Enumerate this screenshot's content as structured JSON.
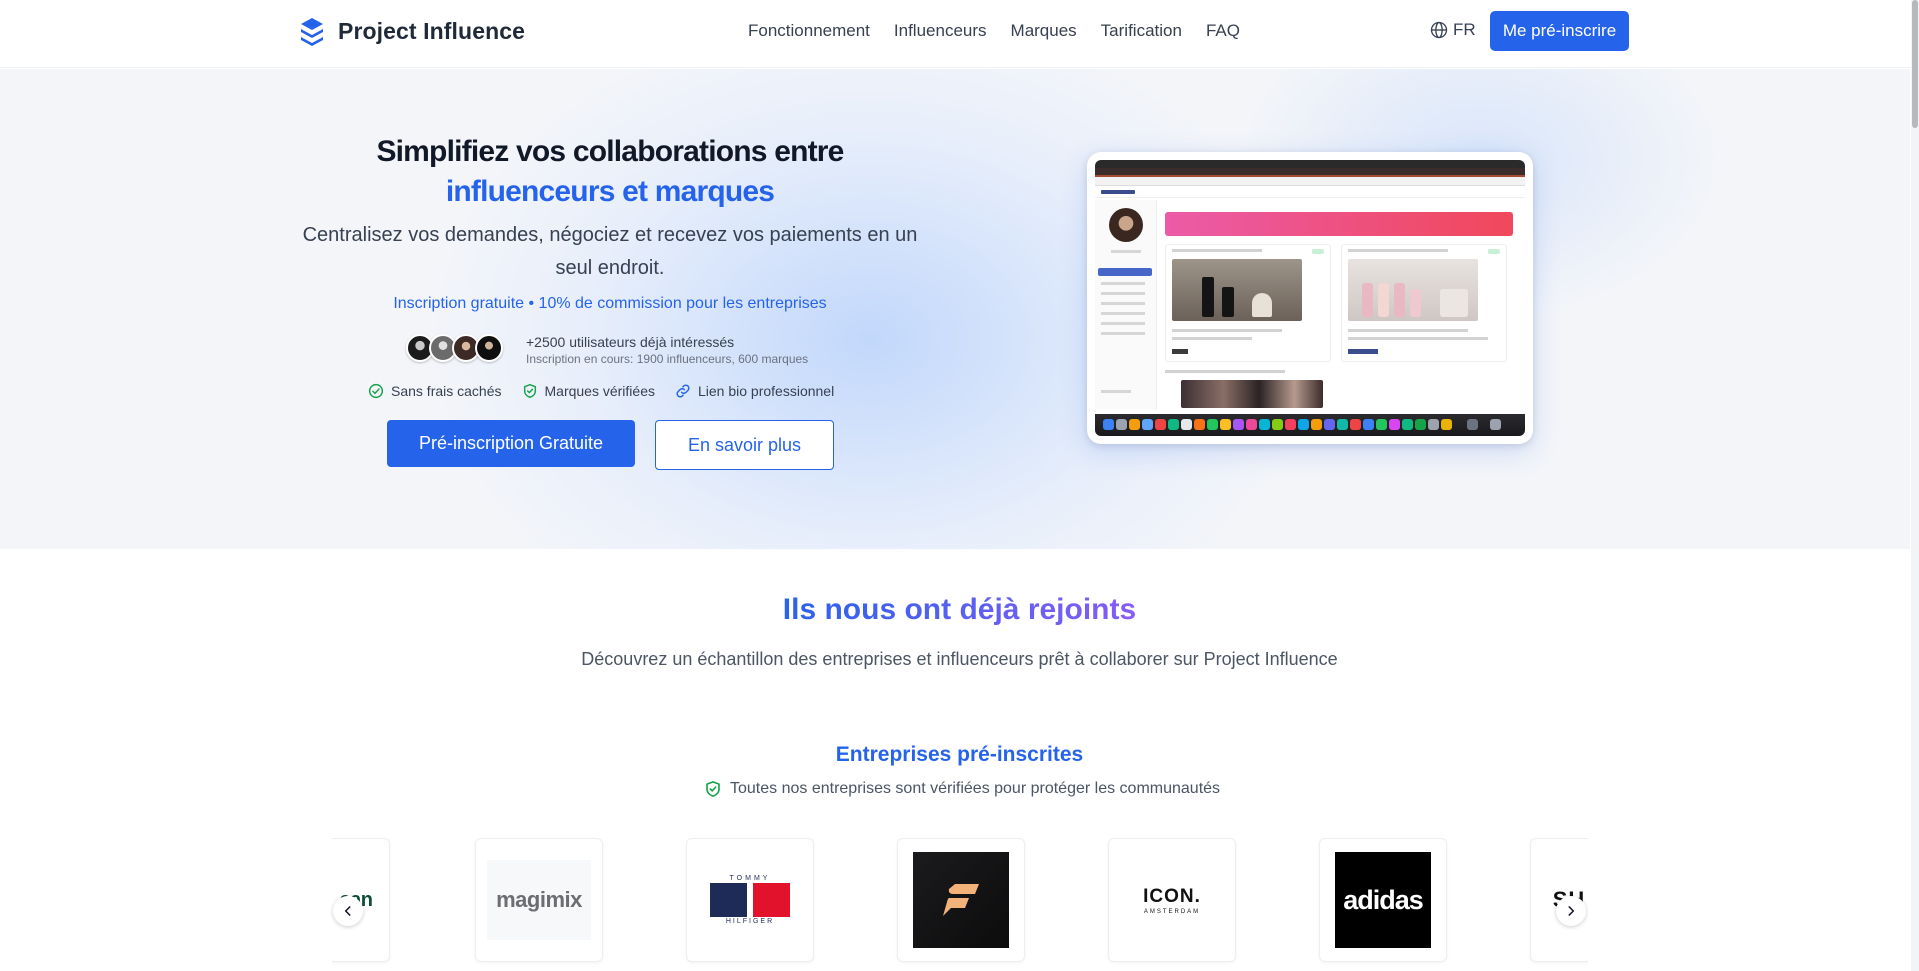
{
  "header": {
    "brand": "Project Influence",
    "nav": [
      "Fonctionnement",
      "Influenceurs",
      "Marques",
      "Tarification",
      "FAQ"
    ],
    "lang": "FR",
    "cta": "Me pré-inscrire"
  },
  "hero": {
    "title_line1": "Simplifiez vos collaborations entre",
    "title_line2": "influenceurs et marques",
    "subtitle": "Centralisez vos demandes, négociez et recevez vos paiements en un seul endroit.",
    "note": "Inscription gratuite • 10% de commission pour les entreprises",
    "users_main": "+2500 utilisateurs déjà intéressés",
    "users_sub": "Inscription en cours: 1900 influenceurs, 600 marques",
    "features": [
      "Sans frais cachés",
      "Marques vérifiées",
      "Lien bio professionnel"
    ],
    "primary_cta": "Pré-inscription Gratuite",
    "secondary_cta": "En savoir plus"
  },
  "joined": {
    "title": "Ils nous ont déjà rejoints",
    "subtitle": "Découvrez un échantillon des entreprises et influenceurs prêt à collaborer sur Project Influence",
    "companies_title": "Entreprises pré-inscrites",
    "companies_verified": "Toutes nos entreprises sont vérifiées pour protéger les communautés",
    "logos": {
      "partial_left": "ean",
      "magimix": "magimix",
      "tommy_top": "TOMMY",
      "tommy_bottom": "HILFIGER",
      "icon_main": "ICON.",
      "icon_sub": "AMSTERDAM",
      "adidas": "adidas",
      "partial_right": "SH"
    }
  },
  "colors": {
    "accent": "#2563eb",
    "accent_purple": "#8b5cf6",
    "verified_green": "#16a34a"
  },
  "icons": {
    "logo": "stacked-layers-icon",
    "lang": "globe-icon",
    "features": [
      "check-circle-icon",
      "shield-check-icon",
      "link-icon"
    ],
    "carousel_prev": "chevron-left-icon",
    "carousel_next": "chevron-right-icon"
  }
}
